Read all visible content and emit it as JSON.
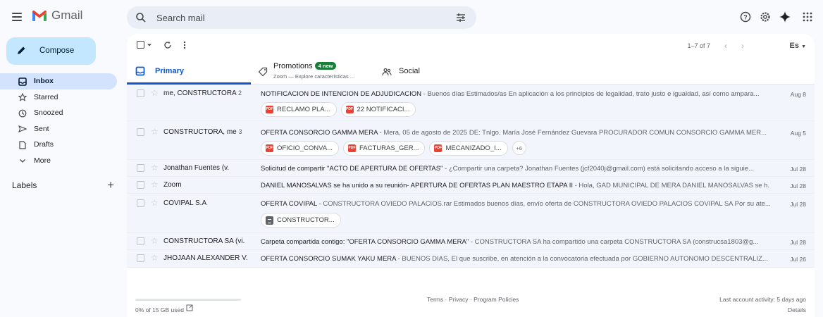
{
  "app": {
    "logo_text": "Gmail"
  },
  "search": {
    "placeholder": "Search mail"
  },
  "compose": {
    "label": "Compose"
  },
  "nav": [
    {
      "label": "Inbox",
      "icon": "inbox-icon",
      "active": true
    },
    {
      "label": "Starred",
      "icon": "star-icon"
    },
    {
      "label": "Snoozed",
      "icon": "clock-icon"
    },
    {
      "label": "Sent",
      "icon": "send-icon"
    },
    {
      "label": "Drafts",
      "icon": "draft-icon"
    },
    {
      "label": "More",
      "icon": "chevron-down-icon"
    }
  ],
  "labels": {
    "heading": "Labels"
  },
  "toolbar": {
    "pagination": "1–7 of 7",
    "language": "Es"
  },
  "tabs": {
    "primary": "Primary",
    "promotions": "Promotions",
    "promotions_badge": "4 new",
    "promotions_sub": "Zoom — Explore características ...",
    "social": "Social"
  },
  "emails": [
    {
      "sender": "me, CONSTRUCTORA",
      "count": "2",
      "subject": "NOTIFICACION DE INTENCION DE ADJUDICACION",
      "snippet": " - Buenos días Estimados/as En aplicación a los principios de legalidad, trato justo e igualdad, así como ampara...",
      "date": "Aug 8",
      "attachments": [
        {
          "type": "pdf",
          "name": "RECLAMO PLA..."
        },
        {
          "type": "pdf",
          "name": "22 NOTIFICACI..."
        }
      ]
    },
    {
      "sender": "CONSTRUCTORA, me",
      "count": "3",
      "subject": "OFERTA CONSORCIO GAMMA MERA",
      "snippet": " - Mera, 05 de agosto de 2025 DE: Tnlgo. María José Fernández Guevara PROCURADOR COMUN CONSORCIO GAMMA MER...",
      "date": "Aug 5",
      "attachments": [
        {
          "type": "pdf",
          "name": "OFICIO_CONVA..."
        },
        {
          "type": "pdf",
          "name": "FACTURAS_GER..."
        },
        {
          "type": "pdf",
          "name": "MECANIZADO_I..."
        }
      ],
      "more_attachments": "+6"
    },
    {
      "sender": "Jonathan Fuentes (v.",
      "subject": "Solicitud de compartir \"ACTO DE APERTURA DE OFERTAS\"",
      "snippet": " - ¿Compartir una carpeta? Jonathan Fuentes (jcf2040j@gmail.com) está solicitando acceso a la siguie...",
      "date": "Jul 28"
    },
    {
      "sender": "Zoom",
      "subject": "DANIEL MANOSALVAS se ha unido a su reunión- APERTURA DE OFERTAS PLAN MAESTRO ETAPA II",
      "snippet": " - Hola, GAD MUNICIPAL DE MERA DANIEL MANOSALVAS se h...",
      "date": "Jul 28"
    },
    {
      "sender": "COVIPAL S.A",
      "subject": "OFERTA COVIPAL",
      "snippet": " - CONSTRUCTORA OVIEDO PALACIOS.rar Estimados buenos días, envío oferta de CONSTRUCTORA OVIEDO PALACIOS COVIPAL SA Por su ate...",
      "date": "Jul 28",
      "attachments": [
        {
          "type": "doc",
          "name": "CONSTRUCTOR..."
        }
      ]
    },
    {
      "sender": "CONSTRUCTORA SA (vi.",
      "subject": "Carpeta compartida contigo: \"OFERTA CONSORCIO GAMMA MERA\"",
      "snippet": " - CONSTRUCTORA SA ha compartido una carpeta CONSTRUCTORA SA (construcsa1803@g...",
      "date": "Jul 28"
    },
    {
      "sender": "JHOJAAN ALEXANDER V.",
      "subject": "OFERTA CONSORCIO SUMAK YAKU MERA",
      "snippet": " - BUENOS DIAS, El que suscribe, en atención a la convocatoria efectuada por GOBIERNO AUTONOMO DESCENTRALIZ...",
      "date": "Jul 26"
    }
  ],
  "footer": {
    "storage_text": "0% of 15 GB used",
    "storage_fraction": 0,
    "terms": "Terms · Privacy · Program Policies",
    "activity": "Last account activity: 5 days ago",
    "details": "Details"
  },
  "colors": {
    "accent": "#0b57d0",
    "compose_bg": "#c2e7ff",
    "active_nav": "#d3e3fd",
    "new_badge": "#188038"
  }
}
